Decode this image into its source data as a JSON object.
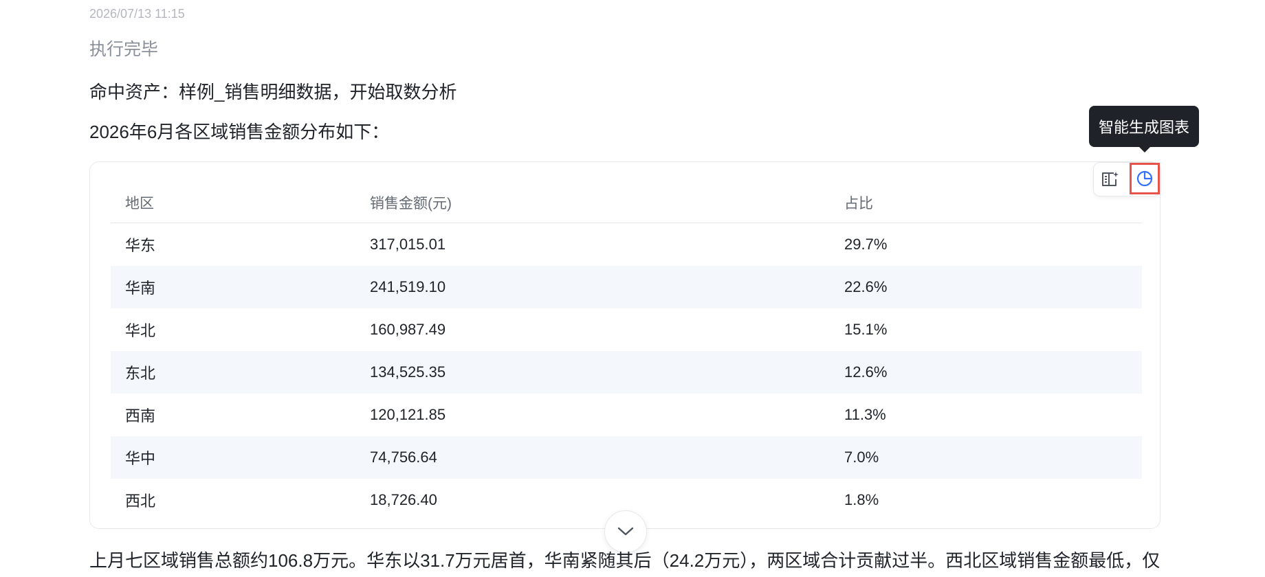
{
  "message": {
    "timestamp": "2026/07/13 11:15",
    "status": "执行完毕",
    "hit_asset_line": "命中资产：样例_销售明细数据，开始取数分析",
    "intro_line": "2026年6月各区域销售金额分布如下：",
    "summary": "上月七区域销售总额约106.8万元。华东以31.7万元居首，华南紧随其后（24.2万元），两区域合计贡献过半。西北区域销售金额最低，仅"
  },
  "table": {
    "headers": [
      "地区",
      "销售金额(元)",
      "占比"
    ],
    "rows": [
      [
        "华东",
        "317,015.01",
        "29.7%"
      ],
      [
        "华南",
        "241,519.10",
        "22.6%"
      ],
      [
        "华北",
        "160,987.49",
        "15.1%"
      ],
      [
        "东北",
        "134,525.35",
        "12.6%"
      ],
      [
        "西南",
        "120,121.85",
        "11.3%"
      ],
      [
        "华中",
        "74,756.64",
        "7.0%"
      ],
      [
        "西北",
        "18,726.40",
        "1.8%"
      ]
    ]
  },
  "toolbar": {
    "tooltip": "智能生成图表",
    "icons": [
      "book-sparkle-icon",
      "pie-chart-icon"
    ]
  },
  "colors": {
    "accent": "#3370ff",
    "highlight_border": "#e5534b",
    "tooltip_bg": "#1f2329",
    "alt_row_bg": "#f4f7fc"
  }
}
